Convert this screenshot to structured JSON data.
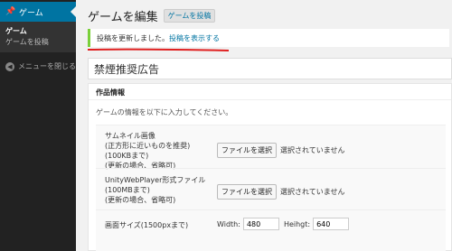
{
  "sidebar": {
    "active_label": "ゲーム",
    "active_icon": "pin-icon",
    "sub_items": [
      {
        "label": "ゲーム"
      },
      {
        "label": "ゲームを投稿"
      }
    ],
    "collapse_label": "メニューを閉じる"
  },
  "header": {
    "title": "ゲームを編集",
    "add_new": "ゲームを投稿"
  },
  "notice": {
    "text": "投稿を更新しました。",
    "link": "投稿を表示する",
    "accent": "#7ad03a"
  },
  "post_title": "禁煙推奨広告",
  "metabox": {
    "title": "作品情報",
    "description": "ゲームの情報を以下に入力してください。",
    "thumbnail": {
      "label_lines": [
        "サムネイル画像",
        "(正方形に近いものを推奨)",
        "(100KBまで)",
        "(更新の場合、省略可)"
      ],
      "button": "ファイルを選択",
      "status": "選択されていません"
    },
    "unity_file": {
      "label_lines": [
        "UnityWebPlayer形式ファイル",
        "(100MBまで)",
        "(更新の場合、省略可)"
      ],
      "button": "ファイルを選択",
      "status": "選択されていません"
    },
    "screen_size": {
      "label": "画面サイズ(1500pxまで)",
      "width_label": "Width:",
      "width_value": "480",
      "height_label": "Heihgt:",
      "height_value": "640"
    }
  },
  "colors": {
    "sidebar_bg": "#222222",
    "active_bg": "#0074a2",
    "link": "#0074a2"
  }
}
